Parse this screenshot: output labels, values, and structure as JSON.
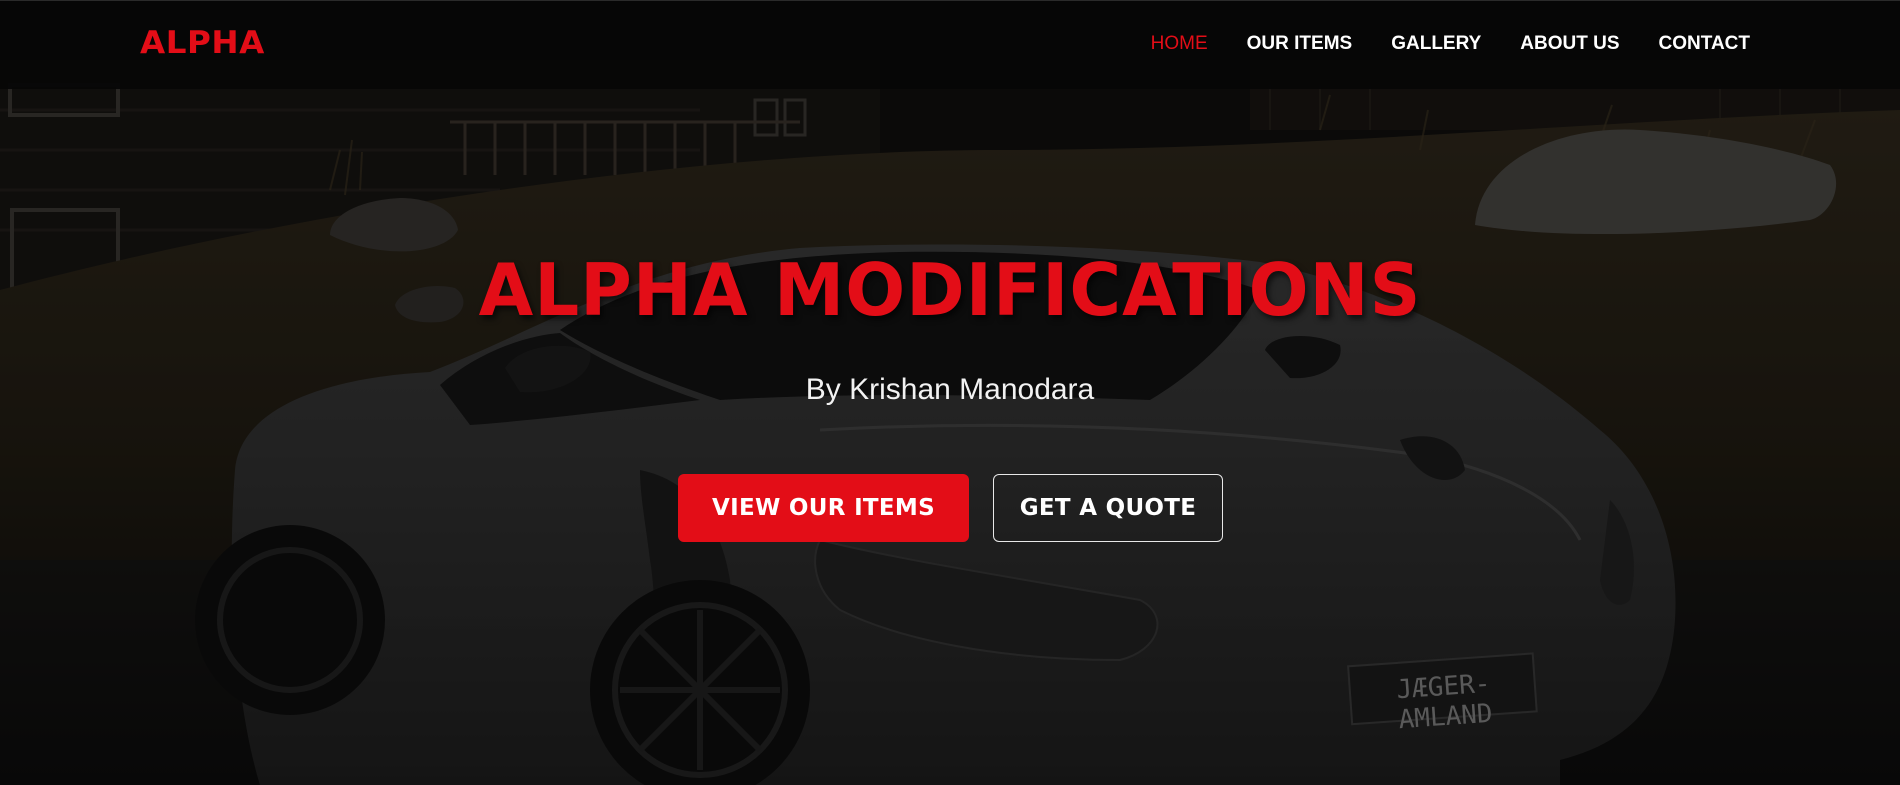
{
  "brand": {
    "logo": "ALPHA",
    "accent_color": "#e30d17"
  },
  "nav": {
    "items": [
      {
        "label": "HOME",
        "active": true
      },
      {
        "label": "OUR ITEMS",
        "active": false
      },
      {
        "label": "GALLERY",
        "active": false
      },
      {
        "label": "ABOUT US",
        "active": false
      },
      {
        "label": "CONTACT",
        "active": false
      }
    ]
  },
  "hero": {
    "title": "ALPHA MODIFICATIONS",
    "subtitle": "By Krishan Manodara",
    "primary_button": "VIEW OUR ITEMS",
    "secondary_button": "GET A QUOTE",
    "plate_text": "JÆGER-AMLAND"
  }
}
